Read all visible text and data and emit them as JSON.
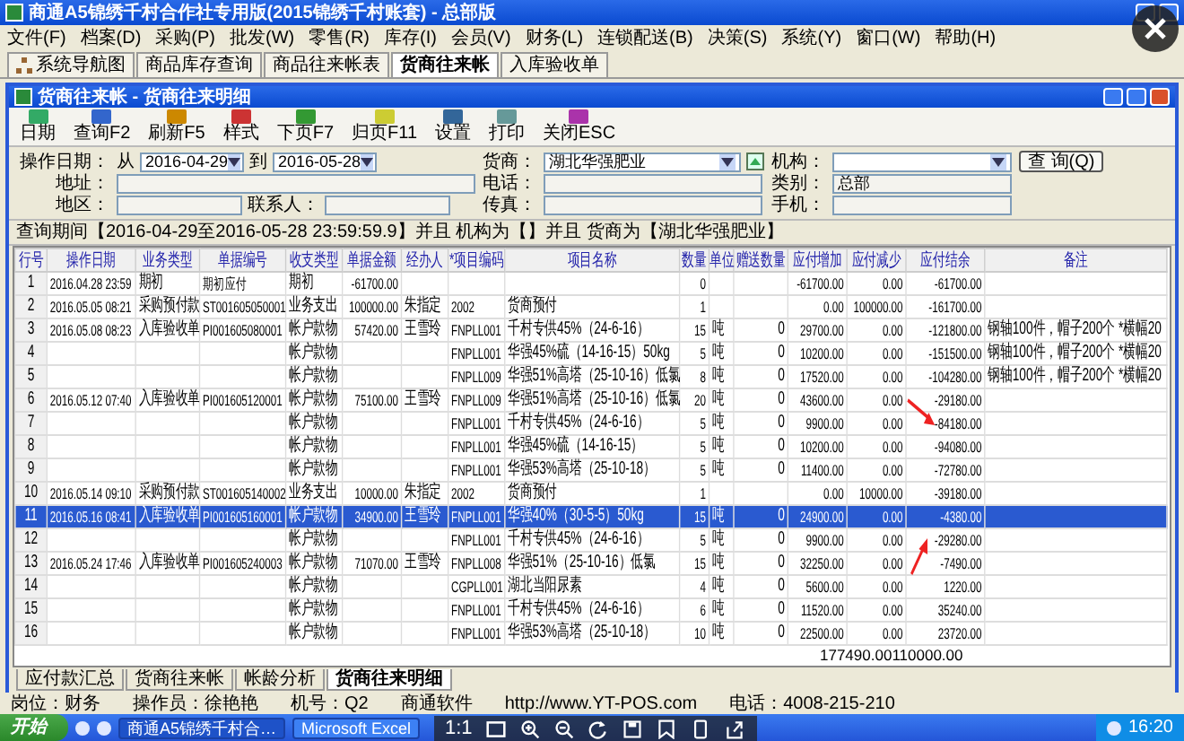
{
  "window": {
    "title": "商通A5锦绣千村合作社专用版(2015锦绣千村账套) - 总部版"
  },
  "menu": [
    "文件(F)",
    "档案(D)",
    "采购(P)",
    "批发(W)",
    "零售(R)",
    "库存(I)",
    "会员(V)",
    "财务(L)",
    "连锁配送(B)",
    "决策(S)",
    "系统(Y)",
    "窗口(W)",
    "帮助(H)"
  ],
  "tabs": [
    {
      "label": "系统导航图",
      "selected": false
    },
    {
      "label": "商品库存查询",
      "selected": false
    },
    {
      "label": "商品往来帐表",
      "selected": false
    },
    {
      "label": "货商往来帐",
      "selected": true
    },
    {
      "label": "入库验收单",
      "selected": false
    }
  ],
  "inner_window": {
    "title": "货商往来帐 - 货商往来明细"
  },
  "toolbar": [
    "日期",
    "查询F2",
    "刷新F5",
    "样式",
    "下页F7",
    "归页F11",
    "设置",
    "打印",
    "关闭ESC"
  ],
  "filters": {
    "date_label": "操作日期：",
    "from_label": "从",
    "from": "2016-04-29",
    "to_label": "到",
    "to": "2016-05-28",
    "supplier_label": "货商：",
    "supplier": "湖北华强肥业",
    "org_label": "机构：",
    "query_button": "查 询(Q)",
    "address_label": "地址：",
    "phone_label": "电话：",
    "category_label": "类别：",
    "category": "总部",
    "region_label": "地区：",
    "contact_label": "联系人：",
    "fax_label": "传真：",
    "mobile_label": "手机："
  },
  "query_summary": "查询期间【2016-04-29至2016-05-28 23:59:59.9】并且  机构为【】并且 货商为【湖北华强肥业】",
  "table": {
    "columns": [
      "行号",
      "操作日期",
      "业务类型",
      "单据编号",
      "收支类型",
      "单据金额",
      "经办人",
      "*项目编码",
      "项目名称",
      "数量",
      "单位",
      "赠送数量",
      "应付增加",
      "应付减少",
      "应付结余",
      "备注"
    ],
    "rows": [
      {
        "selected": false,
        "cells": [
          "1",
          "2016.04.28 23:59",
          "期初",
          "期初应付",
          "期初",
          "-61700.00",
          "",
          "",
          "",
          "0",
          "",
          "",
          "-61700.00",
          "0.00",
          "-61700.00",
          ""
        ]
      },
      {
        "selected": false,
        "cells": [
          "2",
          "2016.05.05 08:21",
          "采购预付款",
          "ST001605050001",
          "业务支出",
          "100000.00",
          "朱指定",
          "2002",
          "货商预付",
          "1",
          "",
          "",
          "0.00",
          "100000.00",
          "-161700.00",
          ""
        ]
      },
      {
        "selected": false,
        "cells": [
          "3",
          "2016.05.08 08:23",
          "入库验收单",
          "PI001605080001",
          "帐户款物",
          "57420.00",
          "王雪玲",
          "FNPLL001",
          "千村专供45%（24-6-16）",
          "15",
          "吨",
          "0",
          "29700.00",
          "0.00",
          "-121800.00",
          "钢轴100件，帽子200个 *横幅20"
        ]
      },
      {
        "selected": false,
        "cells": [
          "4",
          "",
          "",
          "",
          "帐户款物",
          "",
          "",
          "FNPLL001",
          "华强45%硫（14-16-15）50kg",
          "5",
          "吨",
          "0",
          "10200.00",
          "0.00",
          "-151500.00",
          "钢轴100件，帽子200个 *横幅20"
        ]
      },
      {
        "selected": false,
        "cells": [
          "5",
          "",
          "",
          "",
          "帐户款物",
          "",
          "",
          "FNPLL009",
          "华强51%高塔（25-10-16）低氯",
          "8",
          "吨",
          "0",
          "17520.00",
          "0.00",
          "-104280.00",
          "钢轴100件，帽子200个 *横幅20"
        ]
      },
      {
        "selected": false,
        "cells": [
          "6",
          "2016.05.12 07:40",
          "入库验收单",
          "PI001605120001",
          "帐户款物",
          "75100.00",
          "王雪玲",
          "FNPLL009",
          "华强51%高塔（25-10-16）低氯",
          "20",
          "吨",
          "0",
          "43600.00",
          "0.00",
          "-29180.00",
          ""
        ]
      },
      {
        "selected": false,
        "cells": [
          "7",
          "",
          "",
          "",
          "帐户款物",
          "",
          "",
          "FNPLL001",
          "千村专供45%（24-6-16）",
          "5",
          "吨",
          "0",
          "9900.00",
          "0.00",
          "-84180.00",
          ""
        ]
      },
      {
        "selected": false,
        "cells": [
          "8",
          "",
          "",
          "",
          "帐户款物",
          "",
          "",
          "FNPLL001",
          "华强45%硫（14-16-15）",
          "5",
          "吨",
          "0",
          "10200.00",
          "0.00",
          "-94080.00",
          ""
        ]
      },
      {
        "selected": false,
        "cells": [
          "9",
          "",
          "",
          "",
          "帐户款物",
          "",
          "",
          "FNPLL001",
          "华强53%高塔（25-10-18）",
          "5",
          "吨",
          "0",
          "11400.00",
          "0.00",
          "-72780.00",
          ""
        ]
      },
      {
        "selected": false,
        "cells": [
          "10",
          "2016.05.14 09:10",
          "采购预付款",
          "ST001605140002",
          "业务支出",
          "10000.00",
          "朱指定",
          "2002",
          "货商预付",
          "1",
          "",
          "",
          "0.00",
          "10000.00",
          "-39180.00",
          ""
        ]
      },
      {
        "selected": true,
        "cells": [
          "11",
          "2016.05.16 08:41",
          "入库验收单",
          "PI001605160001",
          "帐户款物",
          "34900.00",
          "王雪玲",
          "FNPLL001",
          "华强40%（30-5-5）50kg",
          "15",
          "吨",
          "0",
          "24900.00",
          "0.00",
          "-4380.00",
          ""
        ]
      },
      {
        "selected": false,
        "cells": [
          "12",
          "",
          "",
          "",
          "帐户款物",
          "",
          "",
          "FNPLL001",
          "千村专供45%（24-6-16）",
          "5",
          "吨",
          "0",
          "9900.00",
          "0.00",
          "-29280.00",
          ""
        ]
      },
      {
        "selected": false,
        "cells": [
          "13",
          "2016.05.24 17:46",
          "入库验收单",
          "PI001605240003",
          "帐户款物",
          "71070.00",
          "王雪玲",
          "FNPLL008",
          "华强51%（25-10-16）低氯",
          "15",
          "吨",
          "0",
          "32250.00",
          "0.00",
          "-7490.00",
          ""
        ]
      },
      {
        "selected": false,
        "cells": [
          "14",
          "",
          "",
          "",
          "帐户款物",
          "",
          "",
          "CGPLL001",
          "湖北当阳尿素",
          "4",
          "吨",
          "0",
          "5600.00",
          "0.00",
          "1220.00",
          ""
        ]
      },
      {
        "selected": false,
        "cells": [
          "15",
          "",
          "",
          "",
          "帐户款物",
          "",
          "",
          "FNPLL001",
          "千村专供45%（24-6-16）",
          "6",
          "吨",
          "0",
          "11520.00",
          "0.00",
          "35240.00",
          ""
        ]
      },
      {
        "selected": false,
        "cells": [
          "16",
          "",
          "",
          "",
          "帐户款物",
          "",
          "",
          "FNPLL001",
          "华强53%高塔（25-10-18）",
          "10",
          "吨",
          "0",
          "22500.00",
          "0.00",
          "23720.00",
          ""
        ]
      }
    ],
    "totals": {
      "increase": "177490.00",
      "decrease": "110000.00"
    }
  },
  "bottom_tabs": [
    {
      "label": "应付款汇总",
      "selected": false
    },
    {
      "label": "货商往来帐",
      "selected": false
    },
    {
      "label": "帐龄分析",
      "selected": false
    },
    {
      "label": "货商往来明细",
      "selected": true
    }
  ],
  "status_bar": [
    "岗位：财务",
    "操作员：徐艳艳",
    "机号：Q2",
    "商通软件",
    "http://www.YT-POS.com",
    "电话：4008-215-210"
  ],
  "taskbar": {
    "start": "开始",
    "tasks": [
      {
        "label": "商通A5锦绣千村合…",
        "selected": true
      },
      {
        "label": "Microsoft Excel",
        "selected": false
      }
    ],
    "clock": "16:20"
  },
  "viewer_toolbar": {
    "ratio": "1:1"
  }
}
